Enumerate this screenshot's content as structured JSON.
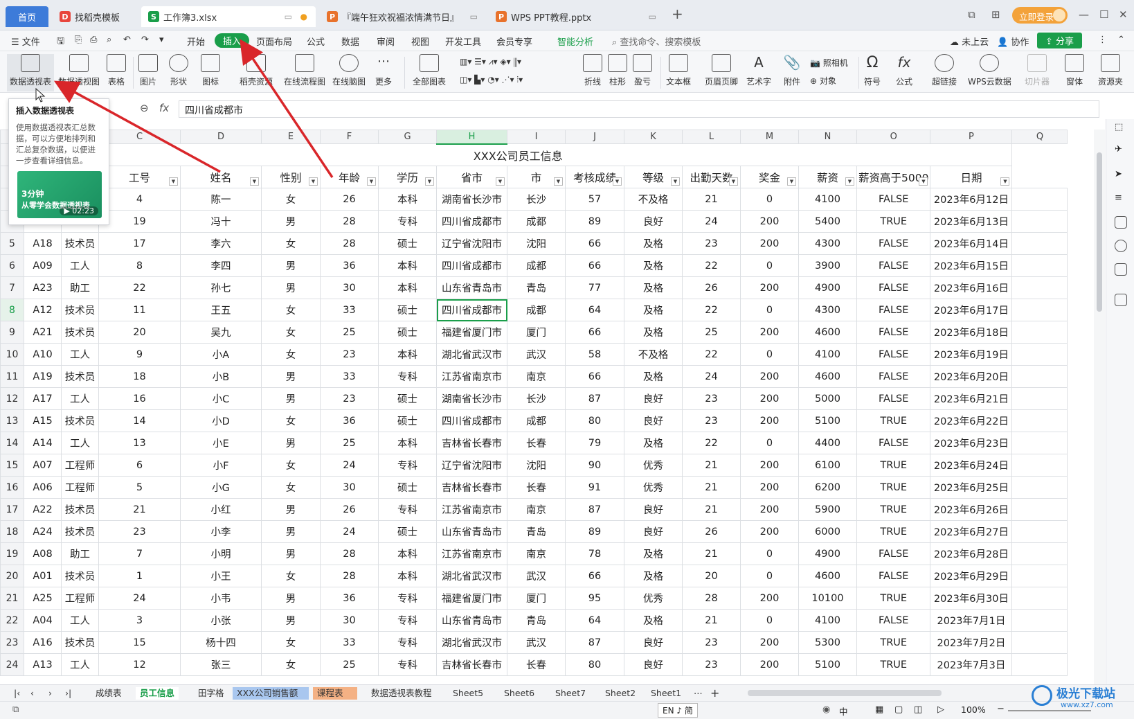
{
  "tabs": [
    {
      "label": "首页"
    },
    {
      "label": "找稻壳模板"
    },
    {
      "label": "工作簿3.xlsx"
    },
    {
      "label": "『端午狂欢祝福浓情满节日』"
    },
    {
      "label": "WPS PPT教程.pptx"
    }
  ],
  "titlebar": {
    "login": "立即登录"
  },
  "menu": {
    "file": "文件",
    "items": [
      "开始",
      "插入",
      "页面布局",
      "公式",
      "数据",
      "审阅",
      "视图",
      "开发工具",
      "会员专享",
      "智能分析"
    ],
    "search": "查找命令、搜索模板",
    "cloud": "未上云",
    "collab": "协作",
    "share": "分享"
  },
  "ribbon": {
    "items": [
      "数据透视表",
      "数据透视图",
      "表格",
      "图片",
      "形状",
      "图标",
      "稻壳资源",
      "在线流程图",
      "在线脑图",
      "更多",
      "全部图表",
      "折线",
      "柱形",
      "盈亏",
      "文本框",
      "页眉页脚",
      "艺术字",
      "附件",
      "照相机",
      "对象",
      "符号",
      "公式",
      "超链接",
      "WPS云数据",
      "切片器",
      "窗体",
      "资源夹"
    ]
  },
  "formula": {
    "fx": "fx",
    "value": "四川省成都市"
  },
  "tooltip": {
    "title": "插入数据透视表",
    "desc": "使用数据透视表汇总数据，可以方便地排列和汇总复杂数据，以便进一步查看详细信息。",
    "video_top": "3分钟",
    "video_title": "从零学会数据透视表",
    "video_time": "02:23"
  },
  "sheet": {
    "col_letters": [
      "",
      "",
      "",
      "C",
      "D",
      "E",
      "F",
      "G",
      "H",
      "I",
      "J",
      "K",
      "L",
      "M",
      "N",
      "O",
      "P",
      "Q"
    ],
    "title": "XXX公司员工信息",
    "headers": [
      "工号",
      "姓名",
      "性别",
      "年龄",
      "学历",
      "省市",
      "市",
      "考核成绩",
      "等级",
      "出勤天数",
      "奖金",
      "薪资",
      "薪资高于5000",
      "日期"
    ],
    "rows": [
      {
        "n": "",
        "a": "",
        "b": "",
        "c": [
          "4",
          "陈一",
          "女",
          "26",
          "本科",
          "湖南省长沙市",
          "长沙",
          "57",
          "不及格",
          "21",
          "0",
          "4100",
          "FALSE",
          "2023年6月12日"
        ]
      },
      {
        "n": "",
        "a": "",
        "b": "",
        "c": [
          "19",
          "冯十",
          "男",
          "28",
          "专科",
          "四川省成都市",
          "成都",
          "89",
          "良好",
          "24",
          "200",
          "5400",
          "TRUE",
          "2023年6月13日"
        ]
      },
      {
        "n": "5",
        "a": "A18",
        "b": "技术员",
        "c": [
          "17",
          "李六",
          "女",
          "28",
          "硕士",
          "辽宁省沈阳市",
          "沈阳",
          "66",
          "及格",
          "23",
          "200",
          "4300",
          "FALSE",
          "2023年6月14日"
        ]
      },
      {
        "n": "6",
        "a": "A09",
        "b": "工人",
        "c": [
          "8",
          "李四",
          "男",
          "36",
          "本科",
          "四川省成都市",
          "成都",
          "66",
          "及格",
          "22",
          "0",
          "3900",
          "FALSE",
          "2023年6月15日"
        ]
      },
      {
        "n": "7",
        "a": "A23",
        "b": "助工",
        "c": [
          "22",
          "孙七",
          "男",
          "30",
          "本科",
          "山东省青岛市",
          "青岛",
          "77",
          "及格",
          "26",
          "200",
          "4900",
          "FALSE",
          "2023年6月16日"
        ]
      },
      {
        "n": "8",
        "a": "A12",
        "b": "技术员",
        "c": [
          "11",
          "王五",
          "女",
          "33",
          "硕士",
          "四川省成都市",
          "成都",
          "64",
          "及格",
          "22",
          "0",
          "4300",
          "FALSE",
          "2023年6月17日"
        ]
      },
      {
        "n": "9",
        "a": "A21",
        "b": "技术员",
        "c": [
          "20",
          "吴九",
          "女",
          "25",
          "硕士",
          "福建省厦门市",
          "厦门",
          "66",
          "及格",
          "25",
          "200",
          "4600",
          "FALSE",
          "2023年6月18日"
        ]
      },
      {
        "n": "10",
        "a": "A10",
        "b": "工人",
        "c": [
          "9",
          "小A",
          "女",
          "23",
          "本科",
          "湖北省武汉市",
          "武汉",
          "58",
          "不及格",
          "22",
          "0",
          "4100",
          "FALSE",
          "2023年6月19日"
        ]
      },
      {
        "n": "11",
        "a": "A19",
        "b": "技术员",
        "c": [
          "18",
          "小B",
          "男",
          "33",
          "专科",
          "江苏省南京市",
          "南京",
          "66",
          "及格",
          "24",
          "200",
          "4600",
          "FALSE",
          "2023年6月20日"
        ]
      },
      {
        "n": "12",
        "a": "A17",
        "b": "工人",
        "c": [
          "16",
          "小C",
          "男",
          "23",
          "硕士",
          "湖南省长沙市",
          "长沙",
          "87",
          "良好",
          "23",
          "200",
          "5000",
          "FALSE",
          "2023年6月21日"
        ]
      },
      {
        "n": "13",
        "a": "A15",
        "b": "技术员",
        "c": [
          "14",
          "小D",
          "女",
          "36",
          "硕士",
          "四川省成都市",
          "成都",
          "80",
          "良好",
          "23",
          "200",
          "5100",
          "TRUE",
          "2023年6月22日"
        ]
      },
      {
        "n": "14",
        "a": "A14",
        "b": "工人",
        "c": [
          "13",
          "小E",
          "男",
          "25",
          "本科",
          "吉林省长春市",
          "长春",
          "79",
          "及格",
          "22",
          "0",
          "4400",
          "FALSE",
          "2023年6月23日"
        ]
      },
      {
        "n": "15",
        "a": "A07",
        "b": "工程师",
        "c": [
          "6",
          "小F",
          "女",
          "24",
          "专科",
          "辽宁省沈阳市",
          "沈阳",
          "90",
          "优秀",
          "21",
          "200",
          "6100",
          "TRUE",
          "2023年6月24日"
        ]
      },
      {
        "n": "16",
        "a": "A06",
        "b": "工程师",
        "c": [
          "5",
          "小G",
          "女",
          "30",
          "硕士",
          "吉林省长春市",
          "长春",
          "91",
          "优秀",
          "21",
          "200",
          "6200",
          "TRUE",
          "2023年6月25日"
        ]
      },
      {
        "n": "17",
        "a": "A22",
        "b": "技术员",
        "c": [
          "21",
          "小红",
          "男",
          "26",
          "专科",
          "江苏省南京市",
          "南京",
          "87",
          "良好",
          "21",
          "200",
          "5900",
          "TRUE",
          "2023年6月26日"
        ]
      },
      {
        "n": "18",
        "a": "A24",
        "b": "技术员",
        "c": [
          "23",
          "小李",
          "男",
          "24",
          "硕士",
          "山东省青岛市",
          "青岛",
          "89",
          "良好",
          "26",
          "200",
          "6000",
          "TRUE",
          "2023年6月27日"
        ]
      },
      {
        "n": "19",
        "a": "A08",
        "b": "助工",
        "c": [
          "7",
          "小明",
          "男",
          "28",
          "本科",
          "江苏省南京市",
          "南京",
          "78",
          "及格",
          "21",
          "0",
          "4900",
          "FALSE",
          "2023年6月28日"
        ]
      },
      {
        "n": "20",
        "a": "A01",
        "b": "技术员",
        "c": [
          "1",
          "小王",
          "女",
          "28",
          "本科",
          "湖北省武汉市",
          "武汉",
          "66",
          "及格",
          "20",
          "0",
          "4600",
          "FALSE",
          "2023年6月29日"
        ]
      },
      {
        "n": "21",
        "a": "A25",
        "b": "工程师",
        "c": [
          "24",
          "小韦",
          "男",
          "36",
          "专科",
          "福建省厦门市",
          "厦门",
          "95",
          "优秀",
          "28",
          "200",
          "10100",
          "TRUE",
          "2023年6月30日"
        ]
      },
      {
        "n": "22",
        "a": "A04",
        "b": "工人",
        "c": [
          "3",
          "小张",
          "男",
          "30",
          "专科",
          "山东省青岛市",
          "青岛",
          "64",
          "及格",
          "21",
          "0",
          "4100",
          "FALSE",
          "2023年7月1日"
        ]
      },
      {
        "n": "23",
        "a": "A16",
        "b": "技术员",
        "c": [
          "15",
          "杨十四",
          "女",
          "33",
          "专科",
          "湖北省武汉市",
          "武汉",
          "87",
          "良好",
          "23",
          "200",
          "5300",
          "TRUE",
          "2023年7月2日"
        ]
      },
      {
        "n": "24",
        "a": "A13",
        "b": "工人",
        "c": [
          "12",
          "张三",
          "女",
          "25",
          "专科",
          "吉林省长春市",
          "长春",
          "80",
          "良好",
          "23",
          "200",
          "5100",
          "TRUE",
          "2023年7月3日"
        ]
      }
    ]
  },
  "sheettabs": [
    "成绩表",
    "员工信息",
    "田字格",
    "XXX公司销售额",
    "课程表",
    "数据透视表教程",
    "Sheet5",
    "Sheet6",
    "Sheet7",
    "Sheet2",
    "Sheet1"
  ],
  "status": {
    "ime": "EN ♪ 简",
    "zoom": "100%",
    "ime2": "中"
  },
  "watermark": {
    "text": "极光下载站",
    "url": "www.xz7.com"
  },
  "colors": {
    "accent": "#1a9e4a",
    "arrow": "#d9262a",
    "home_tab": "#3d7bd9"
  }
}
